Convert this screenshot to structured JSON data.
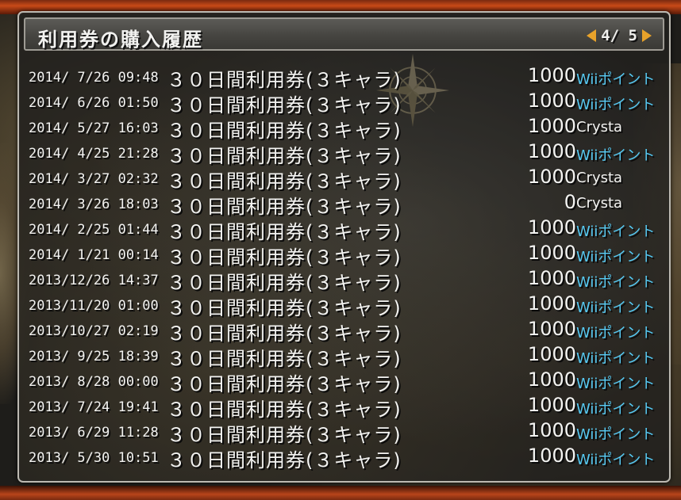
{
  "window": {
    "title": "利用券の購入履歴",
    "page_indicator": "4/ 5"
  },
  "colors": {
    "wii_point": "#56c9f2",
    "crysta": "#f3f3f1",
    "arrow": "#e8a22a"
  },
  "icons": {
    "prev": "triangle-left",
    "next": "triangle-right",
    "background_emblem": "compass-rose"
  },
  "rows": [
    {
      "date": "2014/ 7/26 09:48",
      "item": "３０日間利用券(３キャラ)",
      "amount": "1000",
      "currency": "Wiiポイント",
      "currency_type": "wii"
    },
    {
      "date": "2014/ 6/26 01:50",
      "item": "３０日間利用券(３キャラ)",
      "amount": "1000",
      "currency": "Wiiポイント",
      "currency_type": "wii"
    },
    {
      "date": "2014/ 5/27 16:03",
      "item": "３０日間利用券(３キャラ)",
      "amount": "1000",
      "currency": "Crysta",
      "currency_type": "crysta"
    },
    {
      "date": "2014/ 4/25 21:28",
      "item": "３０日間利用券(３キャラ)",
      "amount": "1000",
      "currency": "Wiiポイント",
      "currency_type": "wii"
    },
    {
      "date": "2014/ 3/27 02:32",
      "item": "３０日間利用券(３キャラ)",
      "amount": "1000",
      "currency": "Crysta",
      "currency_type": "crysta"
    },
    {
      "date": "2014/ 3/26 18:03",
      "item": "３０日間利用券(３キャラ)",
      "amount": "0",
      "currency": "Crysta",
      "currency_type": "crysta"
    },
    {
      "date": "2014/ 2/25 01:44",
      "item": "３０日間利用券(３キャラ)",
      "amount": "1000",
      "currency": "Wiiポイント",
      "currency_type": "wii"
    },
    {
      "date": "2014/ 1/21 00:14",
      "item": "３０日間利用券(３キャラ)",
      "amount": "1000",
      "currency": "Wiiポイント",
      "currency_type": "wii"
    },
    {
      "date": "2013/12/26 14:37",
      "item": "３０日間利用券(３キャラ)",
      "amount": "1000",
      "currency": "Wiiポイント",
      "currency_type": "wii"
    },
    {
      "date": "2013/11/20 01:00",
      "item": "３０日間利用券(３キャラ)",
      "amount": "1000",
      "currency": "Wiiポイント",
      "currency_type": "wii"
    },
    {
      "date": "2013/10/27 02:19",
      "item": "３０日間利用券(３キャラ)",
      "amount": "1000",
      "currency": "Wiiポイント",
      "currency_type": "wii"
    },
    {
      "date": "2013/ 9/25 18:39",
      "item": "３０日間利用券(３キャラ)",
      "amount": "1000",
      "currency": "Wiiポイント",
      "currency_type": "wii"
    },
    {
      "date": "2013/ 8/28 00:00",
      "item": "３０日間利用券(３キャラ)",
      "amount": "1000",
      "currency": "Wiiポイント",
      "currency_type": "wii"
    },
    {
      "date": "2013/ 7/24 19:41",
      "item": "３０日間利用券(３キャラ)",
      "amount": "1000",
      "currency": "Wiiポイント",
      "currency_type": "wii"
    },
    {
      "date": "2013/ 6/29 11:28",
      "item": "３０日間利用券(３キャラ)",
      "amount": "1000",
      "currency": "Wiiポイント",
      "currency_type": "wii"
    },
    {
      "date": "2013/ 5/30 10:51",
      "item": "３０日間利用券(３キャラ)",
      "amount": "1000",
      "currency": "Wiiポイント",
      "currency_type": "wii"
    }
  ]
}
